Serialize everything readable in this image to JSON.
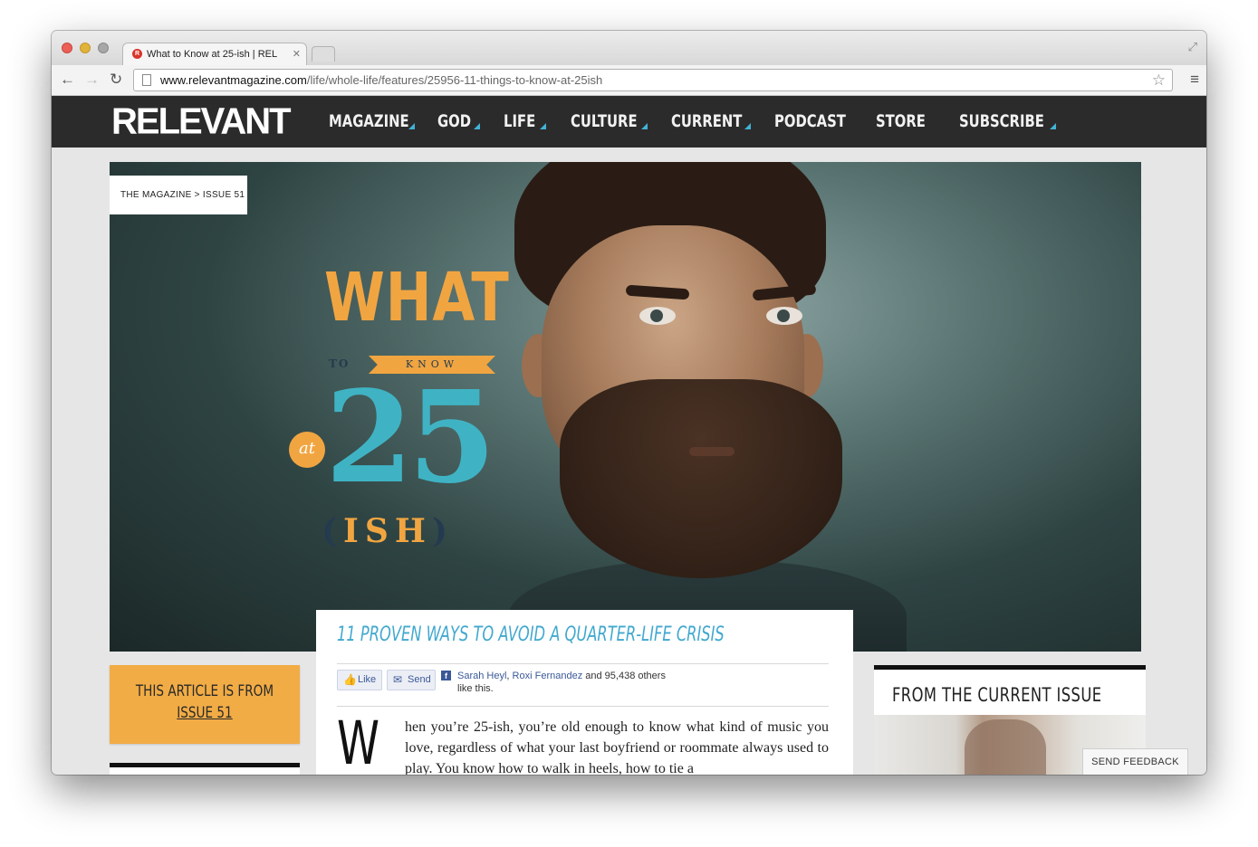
{
  "browser": {
    "tab_title": "What to Know at 25-ish | REL",
    "tab_favicon": "R",
    "url_host": "www.relevantmagazine.com",
    "url_path": "/life/whole-life/features/25956-11-things-to-know-at-25ish"
  },
  "site": {
    "logo": "RELEVANT",
    "accent_color": "#41b2d6",
    "nav": [
      {
        "label": "MAGAZINE",
        "has_dropdown": true
      },
      {
        "label": "GOD",
        "has_dropdown": true
      },
      {
        "label": "LIFE",
        "has_dropdown": true
      },
      {
        "label": "CULTURE",
        "has_dropdown": true
      },
      {
        "label": "CURRENT",
        "has_dropdown": true
      },
      {
        "label": "PODCAST",
        "has_dropdown": false
      },
      {
        "label": "STORE",
        "has_dropdown": false
      },
      {
        "label": "SUBSCRIBE",
        "has_dropdown": true
      }
    ]
  },
  "hero": {
    "breadcrumb": "THE MAGAZINE > ISSUE 51",
    "title_what": "WHAT",
    "title_to": "TO",
    "title_know": "KNOW",
    "title_at": "at",
    "title_number": "25",
    "title_ish": "ISH",
    "paren_open": "(",
    "paren_close": ")"
  },
  "article": {
    "headline": "11 PROVEN WAYS TO AVOID A QUARTER-LIFE CRISIS",
    "like_label": "Like",
    "send_label": "Send",
    "friend_1": "Sarah Heyl",
    "friend_2": "Roxi Fernandez",
    "likes_suffix": "and 95,438 others like this.",
    "dropcap": "W",
    "body": "hen you’re 25-ish, you’re old enough to know what kind of music you love, regardless of what your last boyfriend or roommate always used to play. You know how to walk in heels, how to tie a"
  },
  "sidebar_left": {
    "issue_line": "THIS ARTICLE IS FROM",
    "issue_link": "ISSUE 51"
  },
  "sidebar_right": {
    "current_issue_title": "FROM THE CURRENT ISSUE"
  },
  "feedback": {
    "label": "SEND FEEDBACK"
  }
}
